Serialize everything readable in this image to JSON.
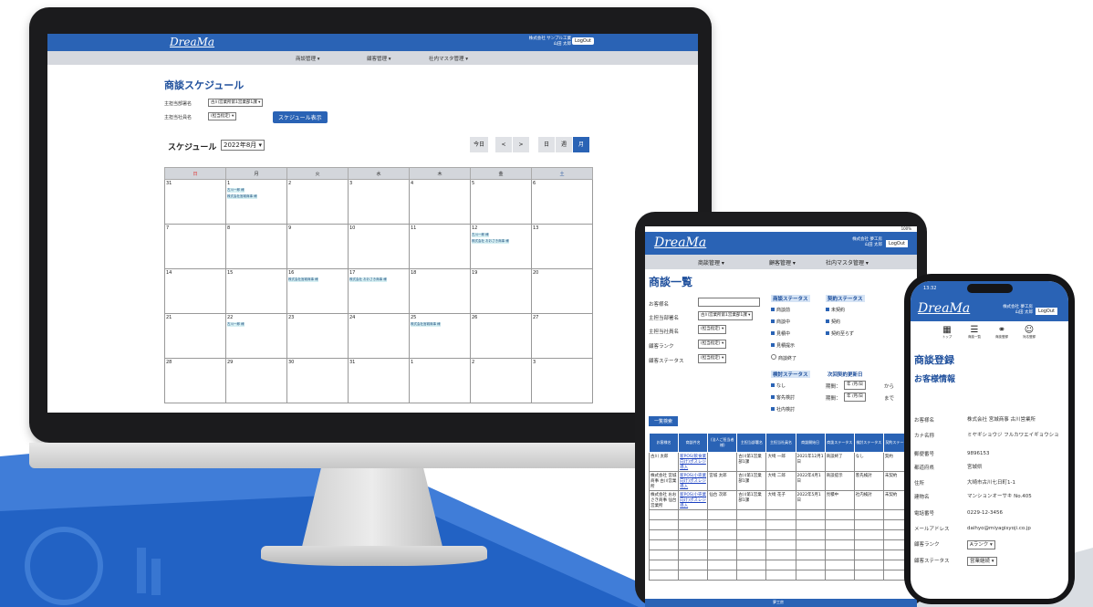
{
  "desktop": {
    "logo": "DreaMa",
    "company": "株式会社 サンプル工業",
    "user": "山田 太郎",
    "logout": "LogOut",
    "menu": [
      "商談管理 ▾",
      "顧客管理 ▾",
      "社内マスタ管理 ▾"
    ],
    "page_title": "商談スケジュール",
    "filter": {
      "dept_label": "主担当部署名",
      "dept_value": "古川営業所第1営業部1課 ▾",
      "staff_label": "主担当社員名",
      "staff_value": "(担当指定) ▾",
      "show_button": "スケジュール表示"
    },
    "schedule_label": "スケジュール",
    "month_select": "2022年8月 ▾",
    "nav": {
      "today": "今日",
      "prev": "<",
      "next": ">",
      "day": "日",
      "week": "週",
      "month": "月"
    },
    "weekdays": [
      "日",
      "月",
      "火",
      "水",
      "木",
      "金",
      "土"
    ],
    "weeks": [
      [
        {
          "d": "31",
          "ev": []
        },
        {
          "d": "1",
          "ev": [
            "古川一郎 様",
            "株式会社宮城商事 様"
          ]
        },
        {
          "d": "2",
          "ev": []
        },
        {
          "d": "3",
          "ev": []
        },
        {
          "d": "4",
          "ev": []
        },
        {
          "d": "5",
          "ev": []
        },
        {
          "d": "6",
          "ev": []
        }
      ],
      [
        {
          "d": "7",
          "ev": []
        },
        {
          "d": "8",
          "ev": []
        },
        {
          "d": "9",
          "ev": []
        },
        {
          "d": "10",
          "ev": []
        },
        {
          "d": "11",
          "ev": []
        },
        {
          "d": "12",
          "ev": [
            "古川一郎 様",
            "株式会社 おおさき商事 様"
          ]
        },
        {
          "d": "13",
          "ev": []
        }
      ],
      [
        {
          "d": "14",
          "ev": []
        },
        {
          "d": "15",
          "ev": []
        },
        {
          "d": "16",
          "ev": [
            "株式会社宮城商事 様"
          ]
        },
        {
          "d": "17",
          "ev": [
            "株式会社 おおさき商事 様"
          ]
        },
        {
          "d": "18",
          "ev": []
        },
        {
          "d": "19",
          "ev": []
        },
        {
          "d": "20",
          "ev": []
        }
      ],
      [
        {
          "d": "21",
          "ev": []
        },
        {
          "d": "22",
          "ev": [
            "古川一郎 様"
          ]
        },
        {
          "d": "23",
          "ev": []
        },
        {
          "d": "24",
          "ev": []
        },
        {
          "d": "25",
          "ev": [
            "株式会社宮城商事 様"
          ]
        },
        {
          "d": "26",
          "ev": []
        },
        {
          "d": "27",
          "ev": []
        }
      ],
      [
        {
          "d": "28",
          "ev": []
        },
        {
          "d": "29",
          "ev": []
        },
        {
          "d": "30",
          "ev": []
        },
        {
          "d": "31",
          "ev": []
        },
        {
          "d": "1",
          "ev": []
        },
        {
          "d": "2",
          "ev": []
        },
        {
          "d": "3",
          "ev": []
        }
      ]
    ]
  },
  "tablet": {
    "status": "100%",
    "logo": "DreaMa",
    "company": "株式会社 夢工房",
    "user": "山田 太郎",
    "logout": "LogOut",
    "menu": [
      "商談管理 ▾",
      "顧客管理 ▾",
      "社内マスタ管理 ▾"
    ],
    "title": "商談一覧",
    "fields": {
      "customer": "お客様名",
      "dept": "主担当部署名",
      "dept_value": "古川営業所第1営業部1課 ▾",
      "staff": "主担当社員名",
      "staff_value": "(担当指定) ▾",
      "rank": "顧客ランク",
      "rank_value": "(担当指定) ▾",
      "status": "顧客ステータス",
      "status_value": "(担当指定) ▾"
    },
    "deal_status_label": "商談ステータス",
    "deal_status": [
      "商談前",
      "商談中",
      "見積中",
      "見積提示",
      "商談終了"
    ],
    "contract_status_label": "契約ステータス",
    "contract_status": [
      "未契約",
      "契約",
      "契約至らず"
    ],
    "review_label": "検討ステータス",
    "review": [
      "なし",
      "客先検討",
      "社内検討"
    ],
    "next_update_label": "次回契約更新日",
    "period1": "期間：",
    "date_placeholder": "年 /月/日",
    "from": "から",
    "period2": "期間：",
    "to": "まで",
    "search_button": "一覧検索",
    "columns": [
      "お客様名",
      "商談件名",
      "(法人ご担当者様)",
      "主担当部署名",
      "主担当社員名",
      "商談開始日",
      "商談ステータス",
      "検討ステータス",
      "契約ステータス"
    ],
    "rows": [
      [
        "古川 太郎",
        "新POS(飲食業向け)ポスレジ導入",
        "",
        "古川第1営業部1課",
        "大崎 一郎",
        "2021年12月1日",
        "商談終了",
        "なし",
        "契約"
      ],
      [
        "株式会社 宮城商事 古川営業所",
        "新POS(小売業向け)ポスレジ導入",
        "宮城 太郎",
        "古川第1営業部1課",
        "大崎 二郎",
        "2022年4月1日",
        "商談提示",
        "客先検討",
        "未契約"
      ],
      [
        "株式会社 おおさき商事 仙台営業所",
        "新POS(小売業向け)ポスレジ導入",
        "仙台 次郎",
        "古川第1営業部1課",
        "大崎 花子",
        "2022年5月1日",
        "見積中",
        "社内検討",
        "未契約"
      ]
    ],
    "footer": "夢工房"
  },
  "phone": {
    "time": "13:32",
    "logo": "DreaMa",
    "company": "株式会社 夢工房",
    "user": "山田 太郎",
    "logout": "LogOut",
    "icons": [
      {
        "label": "トップ",
        "icon": "calendar-icon",
        "glyph": "▦"
      },
      {
        "label": "商談一覧",
        "icon": "list-icon",
        "glyph": "☰"
      },
      {
        "label": "商談登録",
        "icon": "handshake-icon",
        "glyph": "⚭"
      },
      {
        "label": "対応登録",
        "icon": "users-icon",
        "glyph": "☺"
      }
    ],
    "title": "商談登録",
    "subtitle": "お客様情報",
    "rows": [
      {
        "k": "お客様名",
        "v": "株式会社 宮城商事 古川営業所"
      },
      {
        "k": "カナ名称",
        "v": "ミヤギショウジ フルカワエイギョウショ"
      },
      {
        "k": "郵便番号",
        "v": "9896153"
      },
      {
        "k": "都道府県",
        "v": "宮城県"
      },
      {
        "k": "住所",
        "v": "大崎市古川七日町1-1"
      },
      {
        "k": "建物名",
        "v": "マンションオーサキ No.405"
      },
      {
        "k": "電話番号",
        "v": "0229-12-3456"
      },
      {
        "k": "メールアドレス",
        "v": "daihyo@miyagisyoji.co.jp"
      },
      {
        "k": "顧客ランク",
        "v": "Aランク ▾"
      },
      {
        "k": "顧客ステータス",
        "v": "営業継続 ▾"
      }
    ]
  },
  "colors": {
    "brand": "#2a63b5",
    "title": "#1e4f9c",
    "bg_accent": "#1f6fd0"
  }
}
